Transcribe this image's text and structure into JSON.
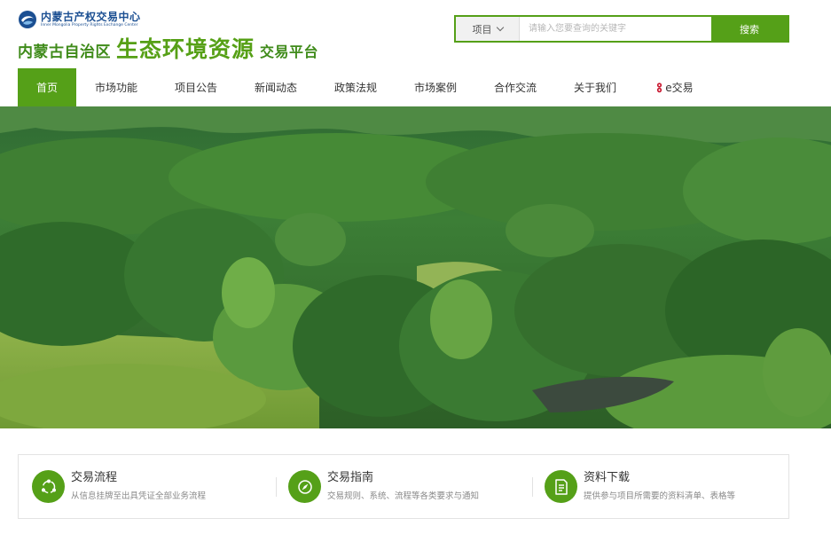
{
  "header": {
    "logo_cn": "内蒙古产权交易中心",
    "logo_en": "Inner Mongolia Property Rights Exchange Center",
    "platform_region": "内蒙古自治区",
    "platform_main": "生态环境资源",
    "platform_sub": "交易平台"
  },
  "search": {
    "category": "项目",
    "placeholder": "请输入您要查询的关键字",
    "button": "搜索"
  },
  "nav": {
    "items": [
      "首页",
      "市场功能",
      "项目公告",
      "新闻动态",
      "政策法规",
      "市场案例",
      "合作交流",
      "关于我们",
      "e交易"
    ],
    "active_index": 0
  },
  "services": [
    {
      "title": "交易流程",
      "desc": "从信息挂牌至出具凭证全部业务流程",
      "icon": "flow-cycle-icon"
    },
    {
      "title": "交易指南",
      "desc": "交易规则、系统、流程等各类要求与通知",
      "icon": "compass-icon"
    },
    {
      "title": "资料下载",
      "desc": "提供参与项目所需要的资料清单、表格等",
      "icon": "document-icon"
    }
  ],
  "colors": {
    "brand_green": "#55a018",
    "logo_blue": "#1b4f92",
    "e_icon_red": "#c8162e"
  }
}
